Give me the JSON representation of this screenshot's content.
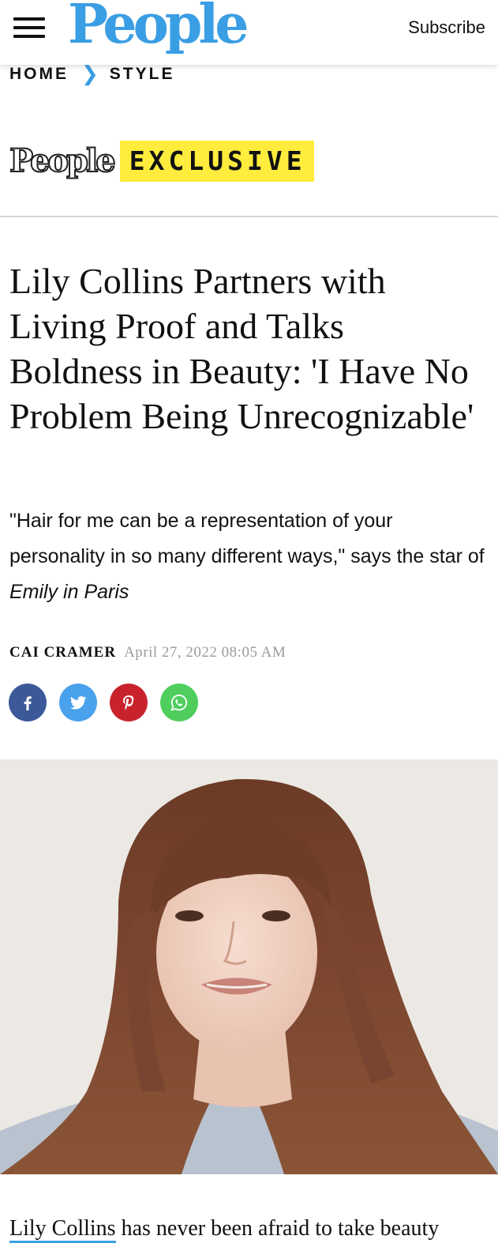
{
  "header": {
    "logo_text": "People",
    "subscribe_label": "Subscribe",
    "menu_icon": "hamburger-menu-icon"
  },
  "breadcrumb": {
    "items": [
      "HOME",
      "STYLE"
    ],
    "separator_icon": "chevron-right-icon"
  },
  "exclusive": {
    "logo_text": "People",
    "badge_text": "EXCLUSIVE"
  },
  "article": {
    "headline": "Lily Collins Partners with Living Proof and Talks Boldness in Beauty: 'I Have No Problem Being Unrecognizable'",
    "dek_prefix": "\"Hair for me can be a representation of your personality in so many different ways,\" says the star of ",
    "dek_italic": "Emily in Paris",
    "author": "CAI CRAMER",
    "date": "April 27, 2022 08:05 AM",
    "body_link": "Lily Collins",
    "body_text": " has never been afraid to take beauty"
  },
  "share": [
    {
      "name": "facebook",
      "icon": "facebook-icon",
      "color": "#3b5998"
    },
    {
      "name": "twitter",
      "icon": "twitter-icon",
      "color": "#4aa1ec"
    },
    {
      "name": "pinterest",
      "icon": "pinterest-icon",
      "color": "#c8232c"
    },
    {
      "name": "whatsapp",
      "icon": "whatsapp-icon",
      "color": "#4fce5d"
    }
  ],
  "colors": {
    "brand_blue": "#3a9ee4",
    "exclusive_yellow": "#ffec3d",
    "date_gray": "#9a9a9a"
  }
}
